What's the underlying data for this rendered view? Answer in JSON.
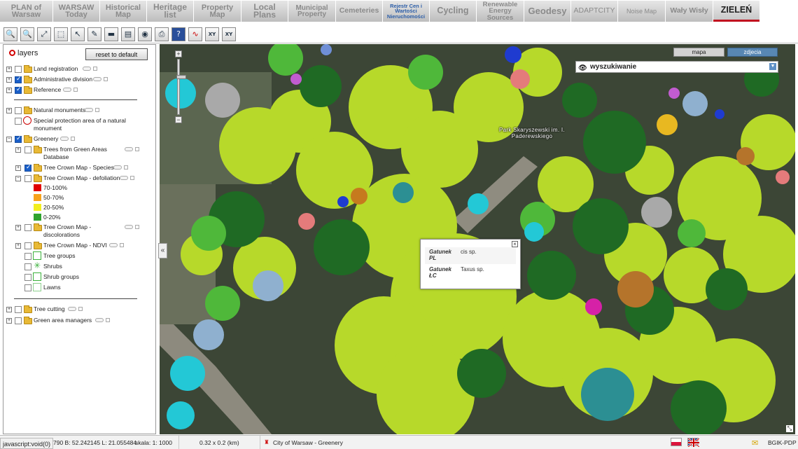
{
  "tabs": [
    {
      "label": "PLAN of Warsaw",
      "active": false
    },
    {
      "label": "WARSAW Today",
      "active": false
    },
    {
      "label": "Historical Map",
      "active": false
    },
    {
      "label": "Heritage list",
      "active": false
    },
    {
      "label": "Property Map",
      "active": false
    },
    {
      "label": "Local Plans",
      "active": false
    },
    {
      "label": "Municipal Property",
      "active": false
    },
    {
      "label": "Cemeteries",
      "active": false
    },
    {
      "label": "Rejestr Cen i Wartości Nieruchomości",
      "active": false
    },
    {
      "label": "Cycling",
      "active": false
    },
    {
      "label": "Renewable Energy Sources",
      "active": false
    },
    {
      "label": "Geodesy",
      "active": false
    },
    {
      "label": "ADAPTCITY",
      "active": false
    },
    {
      "label": "Noise Map",
      "active": false
    },
    {
      "label": "Wały Wisły",
      "active": false
    },
    {
      "label": "ZIELEŃ",
      "active": true
    }
  ],
  "toolbar": {
    "icons": [
      "zoom-in-icon",
      "zoom-out-icon",
      "zoom-extent-icon",
      "zoom-window-icon",
      "select-icon",
      "identify-icon",
      "measure-icon",
      "legend-icon",
      "globe-icon",
      "print-icon",
      "help-icon",
      "chart-icon",
      "xy-icon",
      "xy-goto-icon"
    ],
    "glyphs": [
      "🔍",
      "🔍",
      "⤢",
      "⬚",
      "↖",
      "✎",
      "▬",
      "▤",
      "◉",
      "⎙",
      "?",
      "∿",
      "XY",
      "XY"
    ]
  },
  "layers_panel": {
    "title": "layers",
    "reset_label": "reset to default",
    "items": [
      {
        "label": "Land registration",
        "checked": false
      },
      {
        "label": "Administrative division",
        "checked": true
      },
      {
        "label": "Reference",
        "checked": true
      },
      {
        "label": "Natural monuments",
        "checked": false
      },
      {
        "label": "Special protection area of a natural monument",
        "checked": false
      },
      {
        "label": "Greenery",
        "checked": true
      },
      {
        "label": "Trees from Green Areas Database",
        "checked": false
      },
      {
        "label": "Tree Crown Map - Species",
        "checked": true
      },
      {
        "label": "Tree Crown Map - defoliation",
        "checked": false
      },
      {
        "label": "Tree Crown Map - discolorations",
        "checked": false
      },
      {
        "label": "Tree Crown Map - NDVI",
        "checked": false
      },
      {
        "label": "Tree groups"
      },
      {
        "label": "Shrubs"
      },
      {
        "label": "Shrub groups"
      },
      {
        "label": "Lawns"
      },
      {
        "label": "Tree cutting",
        "checked": false
      },
      {
        "label": "Green area managers",
        "checked": false
      }
    ],
    "defoliation_legend": [
      {
        "label": "70-100%",
        "color": "#e00000"
      },
      {
        "label": "50-70%",
        "color": "#f7a21b"
      },
      {
        "label": "20-50%",
        "color": "#f2ee1f"
      },
      {
        "label": "0-20%",
        "color": "#2fa32f"
      }
    ]
  },
  "map": {
    "basemap_buttons": [
      "mapa",
      "zdjecia"
    ],
    "active_basemap": "zdjecia",
    "search_label": "wyszukiwanie",
    "park_label": "Park Skaryszewski im. I. Paderewskiego",
    "popup": {
      "rows": [
        {
          "key": "Gatunek PL",
          "value": "cis sp."
        },
        {
          "key": "Gatunek ŁC",
          "value": "Taxus sp."
        }
      ]
    }
  },
  "status_bar": {
    "url_tip": "javascript:void(0)",
    "coords": "790 B: 52.242145 L: 21.055484",
    "scale": "skala: 1: 1000",
    "extent": "0.32 x 0.2 (km)",
    "owner": "City of Warsaw - Greenery",
    "credit": "BGIK-PDP"
  }
}
